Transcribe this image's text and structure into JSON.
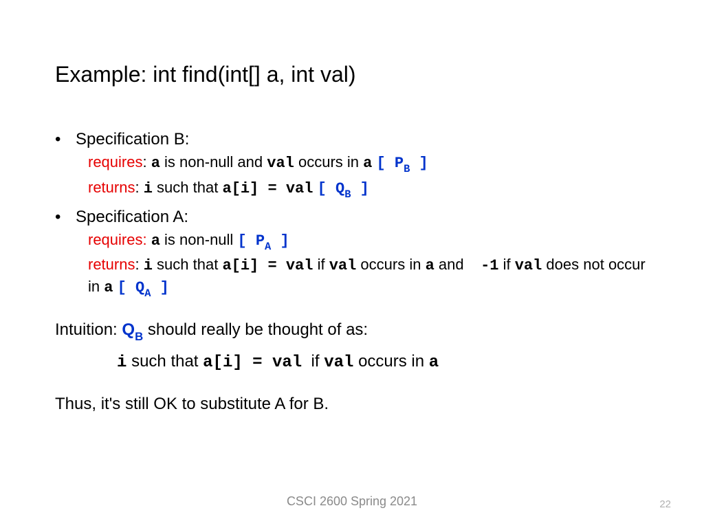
{
  "title": "Example: int find(int[] a, int val)",
  "specB": {
    "header": "Specification B:",
    "requiresLabel": "requires",
    "requiresColon": ": ",
    "req_a": "a",
    "req_mid1": " is non-null and ",
    "req_val": "val",
    "req_mid2": " occurs in ",
    "req_a2": "a",
    "tag_open": "[ P",
    "tag_sub": "B",
    "tag_close": " ]",
    "returnsLabel": "returns",
    "returnsColon": ": ",
    "ret_i": "i",
    "ret_mid1": " such that ",
    "ret_expr": "a[i] = val",
    "qtag_open": "[ Q",
    "qtag_sub": "B",
    "qtag_close": " ]"
  },
  "specA": {
    "header": "Specification A:",
    "requiresLabel": "requires:",
    "req_a": "a",
    "req_text": " is non-null ",
    "tag_open": "[ P",
    "tag_sub": "A",
    "tag_close": " ]",
    "returnsLabel": "returns",
    "returnsColon": ": ",
    "ret_i": "i",
    "ret_mid1": " such that ",
    "ret_expr": "a[i] = val",
    "ret_if": " if ",
    "ret_val": "val",
    "ret_occurs": " occurs in ",
    "ret_a": "a",
    "ret_and": " and    ",
    "ret_neg1": "-1",
    "ret_if2": " if ",
    "ret_val2": "val",
    "ret_notoccur": " does not occur in ",
    "ret_a2": "a",
    "qtag_open": "[ Q",
    "qtag_sub": "A",
    "qtag_close": " ]"
  },
  "intuition": {
    "prefix": "Intuition: ",
    "q_open": "Q",
    "q_sub": "B",
    "suffix": " should really be thought of as:",
    "line2_i": "i",
    "line2_mid1": " such that ",
    "line2_expr": "a[i] = val",
    "line2_if": "  if ",
    "line2_val": "val",
    "line2_occurs": " occurs in ",
    "line2_a": "a"
  },
  "conclusion": "Thus, it's still OK to substitute A for B.",
  "footer": "CSCI 2600 Spring 2021",
  "page": "22",
  "bullet": "•"
}
